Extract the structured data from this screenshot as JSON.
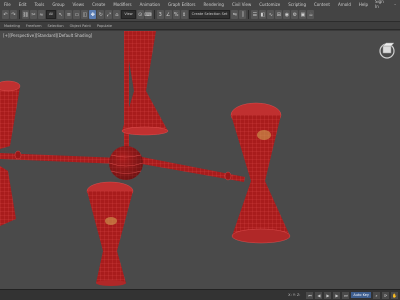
{
  "menubar": {
    "items": [
      "File",
      "Edit",
      "Tools",
      "Group",
      "Views",
      "Create",
      "Modifiers",
      "Animation",
      "Graph Editors",
      "Rendering",
      "Civil View",
      "Customize",
      "Scripting",
      "Content",
      "Arnold",
      "Help"
    ],
    "sign_in": "Sign In"
  },
  "toolbar": {
    "selection_filter": "All",
    "view_dropdown": "View",
    "selection_set": "Create Selection Set"
  },
  "ribbon": {
    "tabs": [
      "Modeling",
      "Freeform",
      "Selection",
      "Object Paint",
      "Populate"
    ]
  },
  "viewport": {
    "label": "[+][Perspective][Standard][Default Shading]"
  },
  "statusbar": {
    "text": "",
    "coords": "X: Y: Z:",
    "auto_key": "Auto Key",
    "selected": "Selected",
    "set_key": "Set Key"
  },
  "colors": {
    "background": "#4a4a4a",
    "lamp_red": "#b02020",
    "wire": "#e05050",
    "accent": "#5a7db3"
  }
}
